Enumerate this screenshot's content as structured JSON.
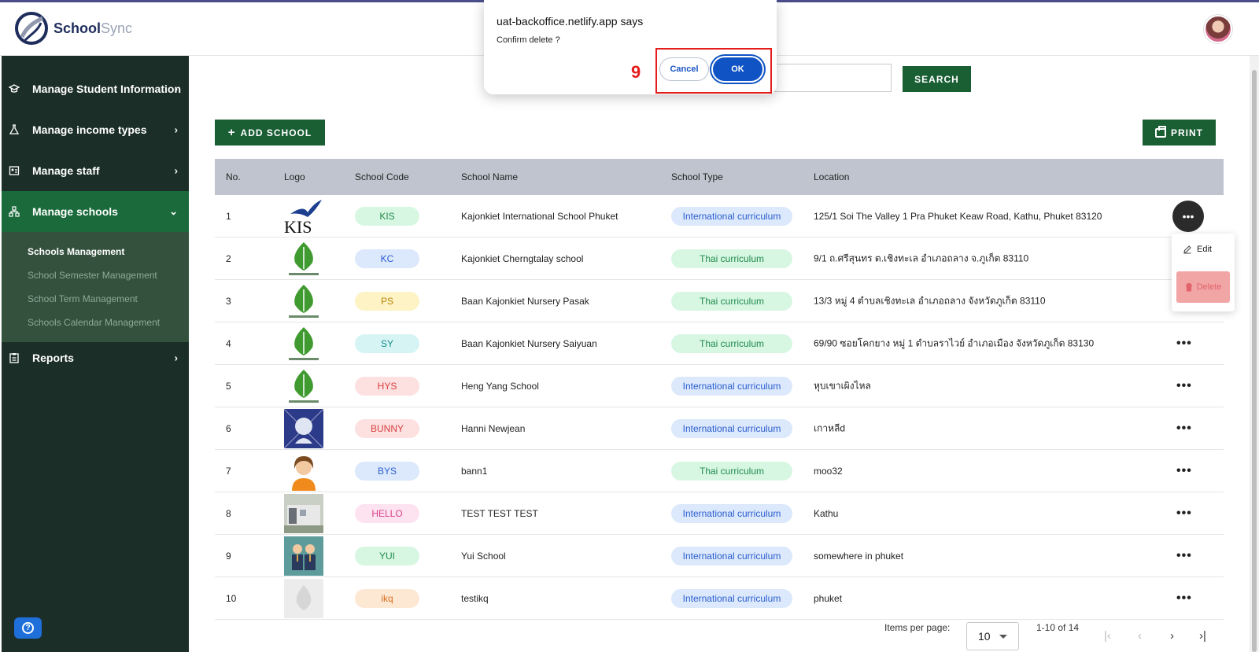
{
  "header": {
    "brand_bold": "School",
    "brand_light": "Sync"
  },
  "dialog": {
    "title": "uat-backoffice.netlify.app says",
    "message": "Confirm delete ?",
    "cancel_label": "Cancel",
    "ok_label": "OK",
    "step_marker": "9"
  },
  "sidebar": {
    "items": [
      {
        "label": "Manage Student Information",
        "icon": "graduation-cap-icon"
      },
      {
        "label": "Manage income types",
        "icon": "flask-icon"
      },
      {
        "label": "Manage staff",
        "icon": "id-badge-icon"
      },
      {
        "label": "Manage schools",
        "icon": "school-network-icon"
      },
      {
        "label": "Reports",
        "icon": "clipboard-icon"
      }
    ],
    "submenu": [
      "Schools Management",
      "School Semester Management",
      "School Term Management",
      "Schools Calendar Management"
    ]
  },
  "toolbar": {
    "search_label": "SEARCH",
    "add_label": "ADD SCHOOL",
    "print_label": "PRINT"
  },
  "table": {
    "headers": [
      "No.",
      "Logo",
      "School Code",
      "School Name",
      "School Type",
      "Location"
    ],
    "rows": [
      {
        "no": "1",
        "code": "KIS",
        "name": "Kajonkiet International School Phuket",
        "type": "International curriculum",
        "location": "125/1 Soi The Valley 1 Pra Phuket Keaw Road, Kathu, Phuket 83120"
      },
      {
        "no": "2",
        "code": "KC",
        "name": "Kajonkiet Cherngtalay school",
        "type": "Thai curriculum",
        "location": "9/1 ถ.ศรีสุนทร ต.เชิงทะเล อำเภอถลาง จ.ภูเก็ต 83110"
      },
      {
        "no": "3",
        "code": "PS",
        "name": "Baan Kajonkiet Nursery Pasak",
        "type": "Thai curriculum",
        "location": "13/3 หมู่ 4 ตำบลเชิงทะเล อำเภอถลาง จังหวัดภูเก็ต 83110"
      },
      {
        "no": "4",
        "code": "SY",
        "name": "Baan Kajonkiet Nursery Saiyuan",
        "type": "Thai curriculum",
        "location": "69/90 ซอยโคกยาง หมู่ 1 ตำบลราไวย์ อำเภอเมือง จังหวัดภูเก็ต 83130"
      },
      {
        "no": "5",
        "code": "HYS",
        "name": "Heng Yang School",
        "type": "International curriculum",
        "location": "หุบเขาเผิงไหล"
      },
      {
        "no": "6",
        "code": "BUNNY",
        "name": "Hanni Newjean",
        "type": "International curriculum",
        "location": "เกาหลีd"
      },
      {
        "no": "7",
        "code": "BYS",
        "name": "bann1",
        "type": "Thai curriculum",
        "location": "moo32"
      },
      {
        "no": "8",
        "code": "HELLO",
        "name": "TEST TEST TEST",
        "type": "International curriculum",
        "location": "Kathu"
      },
      {
        "no": "9",
        "code": "YUI",
        "name": "Yui School",
        "type": "International curriculum",
        "location": "somewhere in phuket"
      },
      {
        "no": "10",
        "code": "ikq",
        "name": "testikq",
        "type": "International curriculum",
        "location": "phuket"
      }
    ],
    "code_colors": {
      "KIS": {
        "bg": "#d8f7e3",
        "fg": "#1f8a4c"
      },
      "KC": {
        "bg": "#dce8fb",
        "fg": "#2a5ecf"
      },
      "PS": {
        "bg": "#fdf3c4",
        "fg": "#b8860b"
      },
      "SY": {
        "bg": "#d6f4f4",
        "fg": "#1a8c8c"
      },
      "HYS": {
        "bg": "#fde0e0",
        "fg": "#d8403f"
      },
      "BUNNY": {
        "bg": "#fde0e0",
        "fg": "#d8403f"
      },
      "BYS": {
        "bg": "#dce8fb",
        "fg": "#2a5ecf"
      },
      "HELLO": {
        "bg": "#fde3f0",
        "fg": "#d8408a"
      },
      "YUI": {
        "bg": "#d8f7e3",
        "fg": "#1f8a4c"
      },
      "ikq": {
        "bg": "#fde8d4",
        "fg": "#d8701f"
      }
    },
    "row_menu": {
      "edit_label": "Edit",
      "delete_label": "Delete"
    }
  },
  "pager": {
    "items_per_page_label": "Items per page:",
    "items_per_page_value": "10",
    "range_label": "1-10 of 14"
  },
  "colors": {
    "sidebar_bg": "#1b2e27",
    "sidebar_active": "#1a6a3b",
    "primary_button": "#1a5e34",
    "dialog_ok": "#0f53c4",
    "highlight": "#e41c1c"
  }
}
